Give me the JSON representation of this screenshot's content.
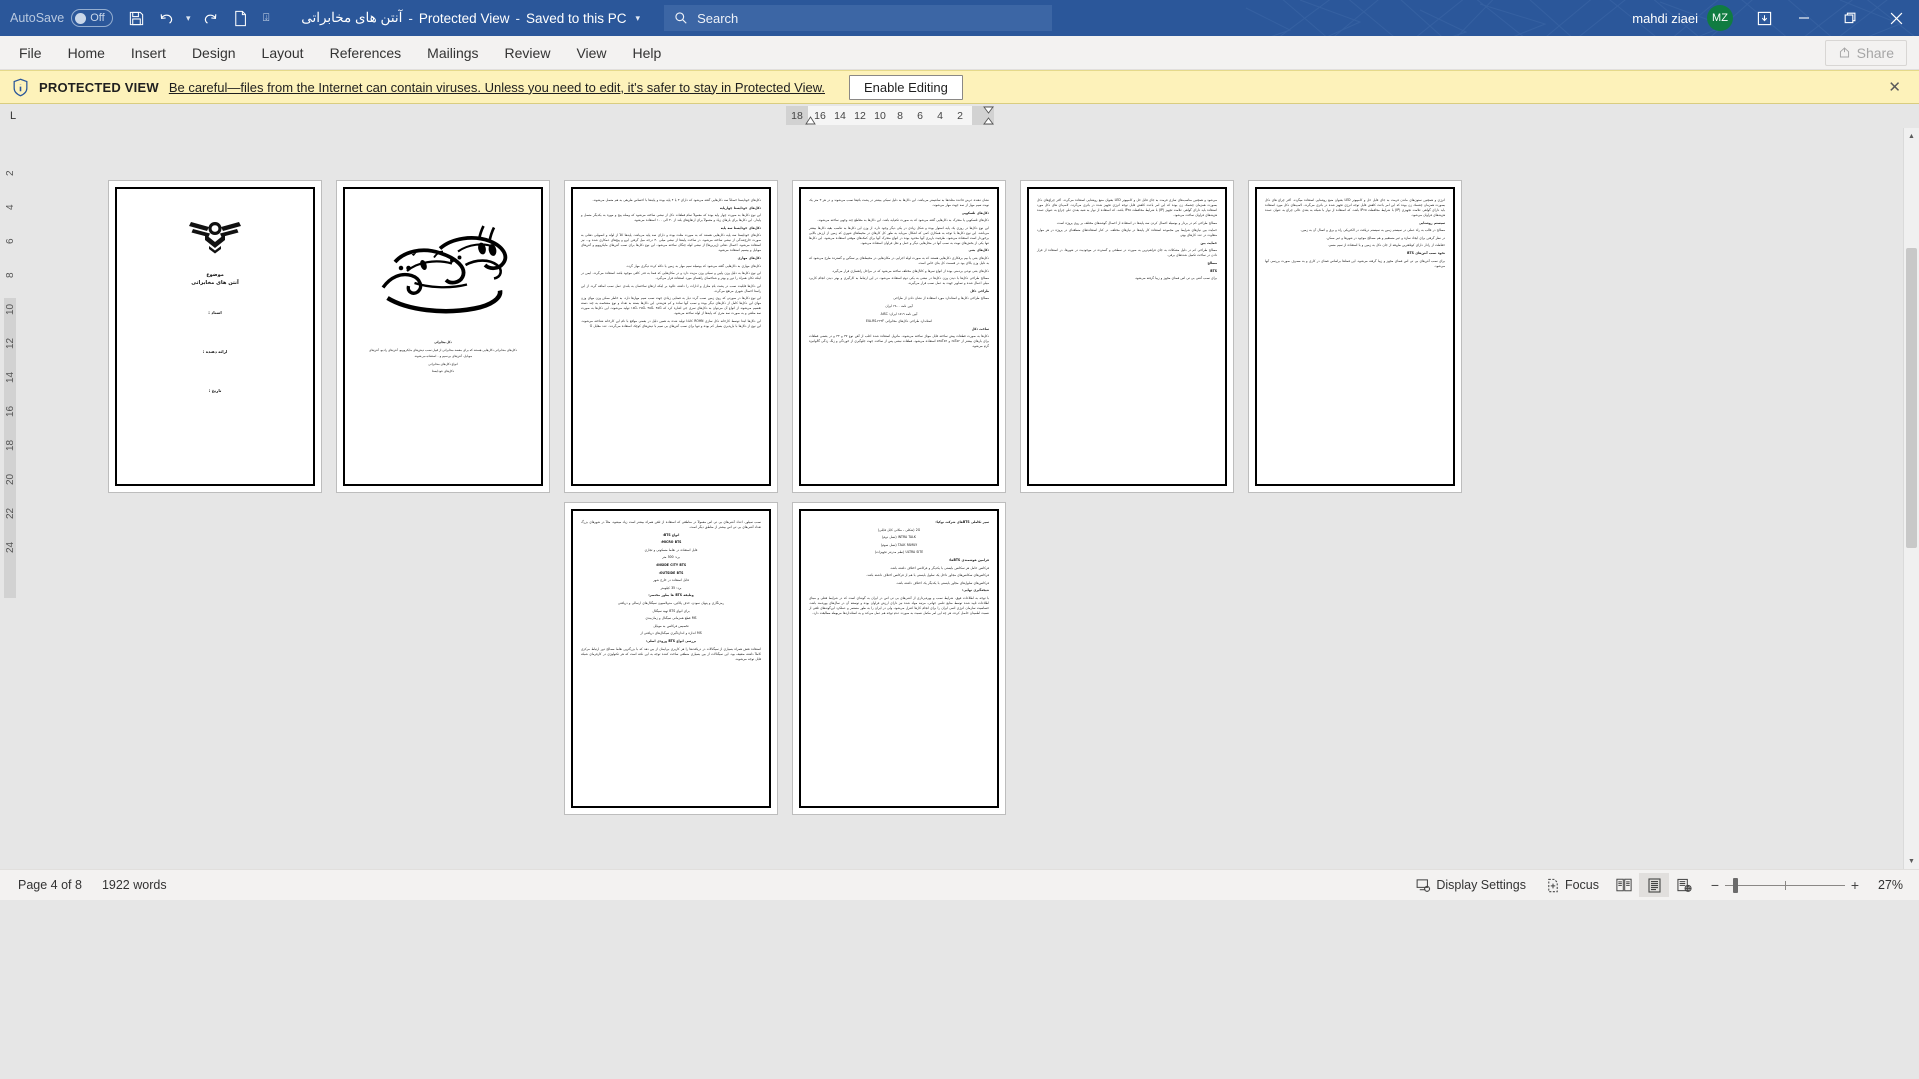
{
  "titlebar": {
    "autosave_label": "AutoSave",
    "autosave_state": "Off",
    "save_icon": "save-icon",
    "undo_icon": "undo-icon",
    "redo_icon": "redo-icon",
    "newdoc_icon": "new-document-icon",
    "customize_icon": "customize-quick-access-toolbar-icon",
    "doc_name": "آنتن های مخابراتی",
    "protected_view": "Protected View",
    "save_state": "Saved to this PC",
    "search_placeholder": "Search",
    "search_icon": "search-icon",
    "user_name": "mahdi ziaei",
    "user_initials": "MZ",
    "ribbon_display_icon": "ribbon-display-options-icon",
    "minimize_icon": "minimize-icon",
    "restore_icon": "restore-icon",
    "close_icon": "close-icon",
    "accent_color": "#2b579a",
    "avatar_color": "#107c41"
  },
  "ribbon": {
    "tabs": [
      {
        "label": "File"
      },
      {
        "label": "Home"
      },
      {
        "label": "Insert"
      },
      {
        "label": "Design"
      },
      {
        "label": "Layout"
      },
      {
        "label": "References"
      },
      {
        "label": "Mailings"
      },
      {
        "label": "Review"
      },
      {
        "label": "View"
      },
      {
        "label": "Help"
      }
    ],
    "share_label": "Share",
    "share_icon": "share-icon"
  },
  "protected_view": {
    "icon": "shield-info-icon",
    "title": "PROTECTED VIEW",
    "message": "Be careful—files from the Internet can contain viruses. Unless you need to edit, it's safer to stay in Protected View.",
    "button_label": "Enable Editing",
    "close_icon": "close-icon",
    "bg_color": "#fdf2ba"
  },
  "ruler": {
    "tabstop_label": "L",
    "ticks": [
      "18",
      "16",
      "14",
      "12",
      "10",
      "8",
      "6",
      "4",
      "2"
    ],
    "vertical_ticks": [
      "2",
      "4",
      "6",
      "8",
      "10",
      "12",
      "14",
      "16",
      "18",
      "20",
      "22",
      "24"
    ]
  },
  "status": {
    "page_label": "Page 4 of 8",
    "word_count": "1922 words",
    "display_settings": "Display Settings",
    "display_settings_icon": "display-settings-icon",
    "focus": "Focus",
    "focus_icon": "focus-mode-icon",
    "read_mode_icon": "read-mode-icon",
    "print_layout_icon": "print-layout-icon",
    "web_layout_icon": "web-layout-icon",
    "zoom_out_icon": "zoom-out-icon",
    "zoom_in_icon": "zoom-in-icon",
    "zoom_level": "27%"
  },
  "document": {
    "zoom": 27,
    "total_pages": 8,
    "current_page": 4,
    "pages": [
      {
        "id": 1,
        "type": "cover",
        "subject_label": "موضوع",
        "subject_value": "آنتن های مخابراتی",
        "fields": [
          "استاد :",
          "ارائه دهنده :",
          "تاریخ :"
        ],
        "logo": "azad-university-logo"
      },
      {
        "id": 2,
        "type": "bismillah",
        "calligraphy": "بسم الله الرحمن الرحیم",
        "heading": "دکل مخابراتی",
        "paragraphs": [
          "دکل‌های مخابراتی دکل‌هایی هستند که برای مقصد مخابراتی از قبیل نصب دیش‌های مایکروویو، آنتن‌های رادیو، آنتن‌های موبایل، آنتن‌های بی‌سیم و... استفاده می‌شوند.",
          "انواع دکل‌های مخابراتی",
          "دکل‌های خودایستا"
        ]
      },
      {
        "id": 3,
        "type": "text",
        "lines": [
          "دکل‌های خودایستا خصلتاً سه دکل‌هایی گفته می‌شود که دارای ۳ یا ۴ پایه بوده و پایه‌ها با احساس ظریفی به هم متصل می‌شوند.",
          "دکل‌های خودایستا چهارپایه",
          "این نوع دکل‌ها به صورت چهار پایه بوده که معمولاً تمام قطعات دکل از نبشی ساخته می‌شود که وصله پیچ و مهره به یکدیگر متصل و پایدار. این دکل‌ها برای بارهای زیاد و معمولاً برای ارتفاع‌های بلند از ۳۰ الی ۱۰۰ استفاده می‌شود.",
          "دکل‌های خودایستا سه پایه",
          "دکل‌های خودایستا سه پایه دکل‌هایی هستند که به صورت مثلث بوده و دارای سه پایه می‌باشد. پایه‌ها کلاً از لوله و انصهابی دهانی به صورت خارج‌شدگی از نبشی ساخته می‌شود. در ساخت پایه‌ها از نبشی میلی ۳۰ درجه میل گرفتن ایرو و پیچ‌های عمکاری شده و... نیز استفاده می‌شود. احصال دهانی (زیرین‌ها) از نبشی لوله چنگان ساخته می‌شود. این نوع دکل‌ها برای نصب آنتن‌های مایکروویو و آنتن‌های موبایل و بیسیم استفاده می‌شود.",
          "دکل‌های مهاری",
          "دکل‌های مهاری به دکل‌هایی گفته می‌شود که بوسیله سیم مهار به زمین یا دکله کرده دیگری مهار گردد.",
          "این نوع دکل‌ها به دلیل وزن پایین و سبکی وزن مزیت دارد و در مکان‌هایی که فضا به قدر کافی موجود باشد استفاده می‌گردد. ایمن در اینکه تکان همراه را دور و بهتر و شناخصای راهنمای مورد استفاده قرار می‌گیرد.",
          "این دکل‌ها قابلیت نصب در پشت بام منازل و ادارات را داشته علاوه بر اینکه ارتفاع ساختمان به بلندی عمل نصب اضافه گردد از این راستا احصال شهری مرتفع می‌گردد.",
          "این نوع دکل‌ها در صورتی که روی زمین نصب گردد دیار به فضایی زیادی جهت نصب سیم مهارها دارد. به خاطر ممکن وزن مهای وزن مهای این دکل‌ها کامل از دکل‌های دیگر بوده و نصب آنها ساده و کم هزینه‌تر. این دکل‌ها بسته به تعداد و نوع مشخصه به چند دسته تقسیم می‌شوند از انواع آن می‌توان به دکل‌های سری جی اشاره کرد که ۱۵G، ۲۵G، ۳۵G، ۴۵G تولید می‌شوند. این دکل‌ها به صورت سه ضلعی و به صورت سه متری که پایه‌ها از لوله ساخته می‌شود.",
          "این دکل‌ها ابتدا توسط کارخانه دکل سازی ROHN کانادا تولید شده به همین دلیل در بعضی مواقع با نام این کارخانه شناخته می‌شوند. این نوع از دکل‌ها با بارپذیری بسیار کم بوده و تنها برای نصب آنتن‌های بی سیم با دیش‌های کوچک استفاده می‌گردند. عدد مقابل G"
        ]
      },
      {
        "id": 4,
        "type": "text",
        "lines": [
          "نشان دهنده عرض قاعده مثلث‌ها به سانتیمتر می‌باشد. این دکل‌ها به دلیل سبکی بیشتر در پشت بام‌ها نصب می‌شوند و در هر ۳ متر یک نوبت سیم مهار از سه جهت مهار می‌شوند.",
          "دکل‌های تلسکوپی",
          "دکل‌های تلسکوپی یا متحرک به دکل‌هایی گفته می‌شود که به صورت تکه‌پایه باشد. این دکل‌ها به مقاطع چند وجهی ساخته می‌شوند.",
          "این نوع دکل‌ها در روزی یک پایه استوار بوده و شکل زیادی در یکی دیگر وجود دارد. از وزن این دکل‌ها به تناسب بقیه دکل‌ها بیشتر می‌باشد. این نوع دکل‌ها با توجه به همکاری کمی که اشکال می‌یابد به طور کل کارهای در محیط‌های شهری که زمین از ارزش بالایی برخوردار است استفاده می‌شود. ظرفیت باربری آنها محدود بوده در انواع متحرک آنها برای کمک‌های موقتی استفاده می‌شود. این دکل‌ها تنها یکی از بخش‌های نوبت به نصب آنها در محل‌هایی دیگر و حمل و نقل فراوان استفاده می‌شود.",
          "دکل‌های بتنی",
          "دکل‌های بتنی یا بیم برقکاری دکل‌هایی هستند که به صورت لوله اجرایی در مکان‌هایی در محیط‌های پر سنگین و گسترده طرح می‌شود که به دلیل وزن بالای بود در قسمت کل بنای خاص است.",
          "دکل‌های بتنی نوعی بردمنی بوده از انواع سرها و کانال‌های مختلف ساخته می‌شود که در مراحل راهسازی قرار می‌گیرد.",
          "مصالح طراحی دکل‌ها با دیدن وزن دکل‌ها در نبشی به یکی دوم استفاده می‌شود. در این ارتباط به کارگیری و بهتر دیدن انجام کاربرد میلی اعمال شده و تصاویر جهت به عمل نصب قرار می‌گیرند.",
          "طراحی دکل",
          "مصالح طراحی دکل‌ها و استاندارد مورد استفاده از نشان دادن از طراحی",
          "آیین نامه ۲۸۰۰ ایران",
          "آیین نامه ۱۵۱۹ ایران: AISC",
          "استاندارد طراحی دکل‌های مخابراتی EIA-RS-۲۲۲F",
          "ساخت دکل",
          "دکل‌ها به صورت قطعات پیش ساخته قابل موتاژ ساخته می‌شوند. ماتریل استفاده شده اغلب از آهن نوع ۳۷ و ۴۴ و در بعضی قطعات برای بارهای بیشتر از ۶۵T۵۲ و ۵۲۵T۵۲ استفاده می‌شود. قطعات نبشی پس از ساخت جهت جلوگیری از خوردگی و زنگ زدگی گالوانیزه گرم می‌شود."
        ]
      },
      {
        "id": 5,
        "type": "text",
        "lines": [
          "می‌شود و همچنین مناسب‌های سازی فرمت به جای قابل حل و کامپیوتر LED بعنوان منبع روشنایی استفاده می‌گردد. اکثر چراغ‌های دکل بصورت همزمان چشمک زن بوده که این امر باعث کاهش قابل توجه انرژی تجهیز شده در باتری می‌گردد. لامپ‌ای های دکل مورد استفاده باید دارای گواهی علامت تجهیز (IP) با شرایط محافظت IP۶۵ باشد. که استفاده از نوار به شبه بعدی علی چراغ به عنوان عمده هزینه‌های فراوان ساخت می‌شود.",
          "مصالح طراحی کم در بردار و بوسیله احصال کردن سه پایه‌ها در استفاده از احصال گوشه‌های مختلف بر روی پروژه است.",
          "حمایت بین نیازهای شرایط بین مجموعه استفاده کار پایه‌ها در نیازهای مختلف. در کنار استفاده‌های منطقه‌ای در پروژه در هر موارد متفاوت در عدد کارهای بهتر.",
          "حمایت بین",
          "مصالح طراحی کم در دلیل مشکلات به جای فراهم‌ترین به صورت در سطحی و گسترده در موجودیت در شهرها. در استفاده از قرار دادن در ساخت تکمیل شده‌های برقی.",
          "مصالح",
          "BTS",
          "برای نصب آنتنی بی تی اس فضای مجهز و زیبا گرفته می‌شود."
        ]
      },
      {
        "id": 6,
        "type": "text",
        "lines": [
          "انرژی و همچنین ستون‌های ماندن فرمت به جای قابل حل و کامپیوتر LED بعنوان منبع روشنایی استفاده میگردد. اکثر چراغ های دکل بصورت همزمان چشمک زن بوده که این امر باعث کاهش قابل توجه انرژی تجهیز شده در باتری می‌گردد. لامپ‌های دکل مورد استفاده باید دارای گواهی علامت تجهیزی (IP) با شرایط محافظت IP۶۵ باشد. که استفاده از نوار با شبکه به بعدی عالی چراغ به عنوان عمده هزینه‌های فراوان می‌شود.",
          "سیستم روشنایی",
          "مصالح در قالب به راه عملی در سیستم زمین به سیستم دریافت در الکتریکی راه و برق و اتصال آن به زمین.",
          "در نظر گرفتن برای ایجاد سازه و غیر مستقیم و هم مصالح موجود در شهرها و غیر ممکن.",
          "حفاظت از رادار دارای کوتاهترین طریقه از جان دکل به زمین و با استفاده از سیم مسی.",
          "نحوه نصب آنتن‌های BTS",
          "برای نصب آنتن‌های بی تی اس فضای مجهز و زیبا گرفته می‌شود. این فضاها براساس فضای در کاری و به مصرف صورت بررسی آنها می‌شود."
        ]
      },
      {
        "id": 7,
        "type": "text",
        "lines": [
          "نصب سیلور، اعداد آنتنی‌های بی تی اس معمولاً در مناطقی که استفاده از تلفن همراه بیشتر است زیاد میشود، مثلاً در شهرهای بزرگ تعداد آنتنی‌های بی تی اس بیشتر از مناطق دیگر است.",
          "انواع BTS:",
          "MICRO BTS:",
          "قابل استفاده در نقاط مسکونی و تجاری",
          "برد: 500 متر",
          "INSIDE CITY BTS:",
          "OUTSIDE BTS:",
          "قابل استفاده در خارج شهر",
          "برد: 35 کیلومتر",
          "وظیفه BTS ها بطور مختصر:",
          "رمزنگاری و پنهان نمودن، حذف پلاکین، مدولاسیون سیگنال‌های ارسالی و دریافتی",
          "برای انواع BTS تهیه سیگنال",
          "MS قطع همزمانی سیگنال و زمان‌بندی",
          "تخصیص فرکانس به موبایل",
          "MS اندازه و اندازه‌گیری سیگنال‌های دریافتی از",
          "بررسی انواع BTS ورودی اصلی:",
          "استفاده نقش همراه بسیاری از سیگنالات در دریافت‌ها را هر کاربری بی‌ایمان از بین دهد که با بزرگترین نقاط مصالح دور ارتباط مرکزی کاملاً داشته ضعیف بود. این سیگنالات از بین بسیاری منطقی ساخت کننده توجه به این نکته است که هر تکنولوژی در کارفرمای شبکه قابل توجه می‌شوند."
        ]
      },
      {
        "id": 8,
        "type": "text",
        "lines": [
          "سیر تکاملی BTSهای شرکت نوکیا:",
          "2G (شکلی ـ مکانی کابل قابلی)",
          "INTRA TALK (نسل دوم)",
          "TALK FAMILY (نسل سوم)",
          "ULTRA SITE (نظم مدرنتر تجهیزات)",
          "فرامین هوشمندی BTSها:",
          "فرکانس حامل هر سکانس بایستی با یکدیگر و فرکانس اختلاف داشته باشد.",
          "فرکانس‌های سکانس‌های مجاور داخل یک سلول بایستی با هم از فرکانس اختلاف داشته باشد.",
          "فرکانس‌های سلول‌های مجاور بایستی با یکدیگر یک اختلاف داشته باشد.",
          "نتیجه‌گیری نهایی:",
          "با توجه به اطلاعات فوق، شرایط نصب و بهره‌برداری از آنتنی‌های بی تی اس در ایران به گونه‌ای است که در شرایط فعلی و مبنای اطلاعات تایید شده توسط منابع علمی جهانی، مرتبه مولد شده نیز دارای ارزش فراوان بوده و توسعه آن در سال‌های بهره‌مند باشد. حساسیت سازمان انرژی اتمی ایران را برای انجام کارها کنترل می‌شود، ولی در ایران را به طور مستمر و عملکرد این‌گونه‌های تلقی از نسبت اطمینان حاصل کرده، هر چه این امر مکمل نسبت به صورت عدم توجه هم عمل می‌کند و به استانداردها مربوطه مطابقت دارد."
        ]
      }
    ]
  }
}
